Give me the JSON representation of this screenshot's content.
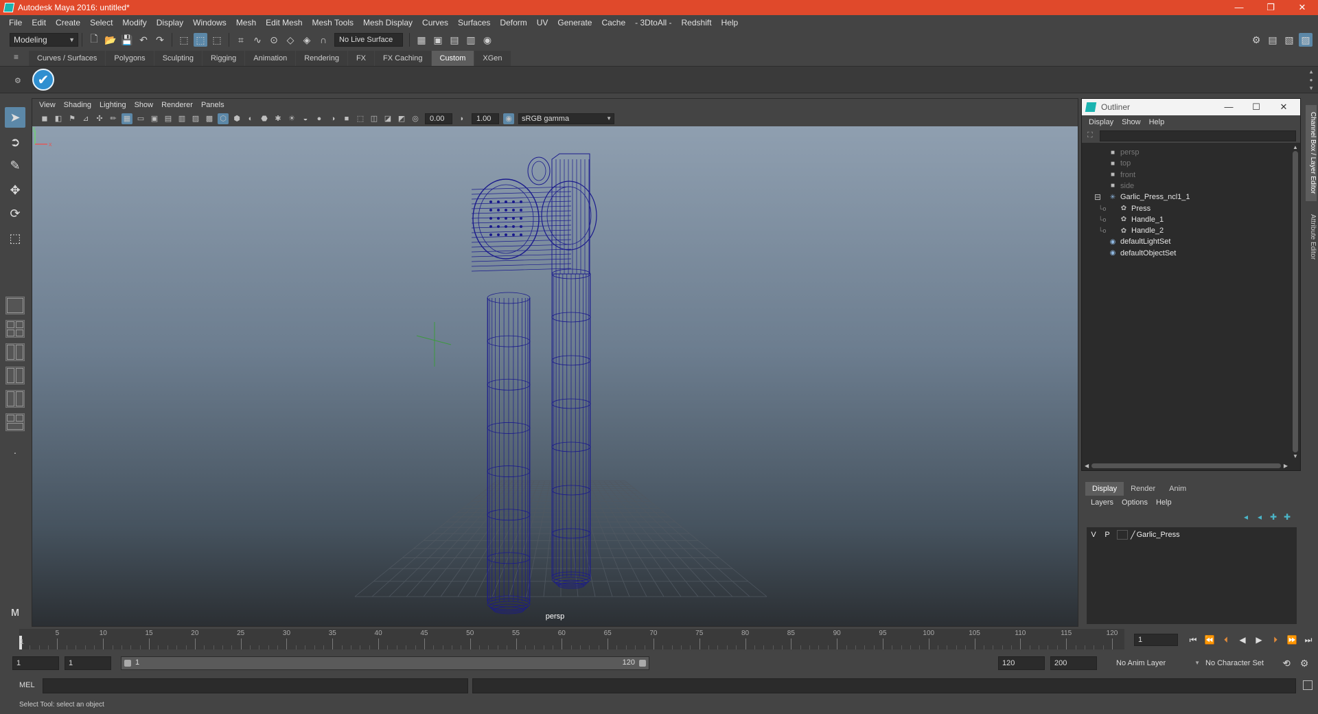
{
  "window": {
    "title": "Autodesk Maya 2016: untitled*",
    "controls": [
      "—",
      "❐",
      "✕"
    ]
  },
  "menubar": [
    "File",
    "Edit",
    "Create",
    "Select",
    "Modify",
    "Display",
    "Windows",
    "Mesh",
    "Edit Mesh",
    "Mesh Tools",
    "Mesh Display",
    "Curves",
    "Surfaces",
    "Deform",
    "UV",
    "Generate",
    "Cache",
    "- 3DtoAll -",
    "Redshift",
    "Help"
  ],
  "statusline": {
    "mode": "Modeling",
    "live_surface": "No Live Surface"
  },
  "shelf": {
    "tabs": [
      "Curves / Surfaces",
      "Polygons",
      "Sculpting",
      "Rigging",
      "Animation",
      "Rendering",
      "FX",
      "FX Caching",
      "Custom",
      "XGen"
    ],
    "active_tab": "Custom"
  },
  "viewport": {
    "menu": [
      "View",
      "Shading",
      "Lighting",
      "Show",
      "Renderer",
      "Panels"
    ],
    "exposure": "0.00",
    "gamma_value": "1.00",
    "color_space": "sRGB gamma",
    "camera_label": "persp",
    "axis_y": "y",
    "axis_x": "x",
    "wireframe_color": "#1a1a8c"
  },
  "outliner": {
    "title": "Outliner",
    "menu": [
      "Display",
      "Show",
      "Help"
    ],
    "items": [
      {
        "label": "persp",
        "icon": "camera-icon",
        "indent": 0,
        "dim": true
      },
      {
        "label": "top",
        "icon": "camera-icon",
        "indent": 0,
        "dim": true
      },
      {
        "label": "front",
        "icon": "camera-icon",
        "indent": 0,
        "dim": true
      },
      {
        "label": "side",
        "icon": "camera-icon",
        "indent": 0,
        "dim": true
      },
      {
        "label": "Garlic_Press_ncl1_1",
        "icon": "group-icon",
        "indent": 0,
        "dim": false,
        "expanded": true
      },
      {
        "label": "Press",
        "icon": "mesh-icon",
        "indent": 1,
        "dim": false
      },
      {
        "label": "Handle_1",
        "icon": "mesh-icon",
        "indent": 1,
        "dim": false
      },
      {
        "label": "Handle_2",
        "icon": "mesh-icon",
        "indent": 1,
        "dim": false
      },
      {
        "label": "defaultLightSet",
        "icon": "set-icon",
        "indent": 0,
        "dim": false
      },
      {
        "label": "defaultObjectSet",
        "icon": "set-icon",
        "indent": 0,
        "dim": false
      }
    ]
  },
  "layer_editor": {
    "tabs": [
      "Display",
      "Render",
      "Anim"
    ],
    "active_tab": "Display",
    "menu": [
      "Layers",
      "Options",
      "Help"
    ],
    "layers": [
      {
        "visible": "V",
        "playback": "P",
        "name": "Garlic_Press"
      }
    ]
  },
  "timeslider": {
    "labels": [
      "1",
      "5",
      "10",
      "15",
      "20",
      "25",
      "30",
      "35",
      "40",
      "45",
      "50",
      "55",
      "60",
      "65",
      "70",
      "75",
      "80",
      "85",
      "90",
      "95",
      "100",
      "105",
      "110",
      "115",
      "120"
    ],
    "current_frame": "1",
    "current_time": 1,
    "end": 120
  },
  "rangeslider": {
    "start": "1",
    "playback_start": "1",
    "range_start_label": "1",
    "range_end_label": "120",
    "playback_end": "120",
    "end": "200",
    "anim_layer": "No Anim Layer",
    "character_set": "No Character Set"
  },
  "cmdline": {
    "label": "MEL"
  },
  "helpline": {
    "text": "Select Tool: select an object"
  },
  "side_tabs": [
    "Channel Box / Layer Editor",
    "Attribute Editor"
  ]
}
